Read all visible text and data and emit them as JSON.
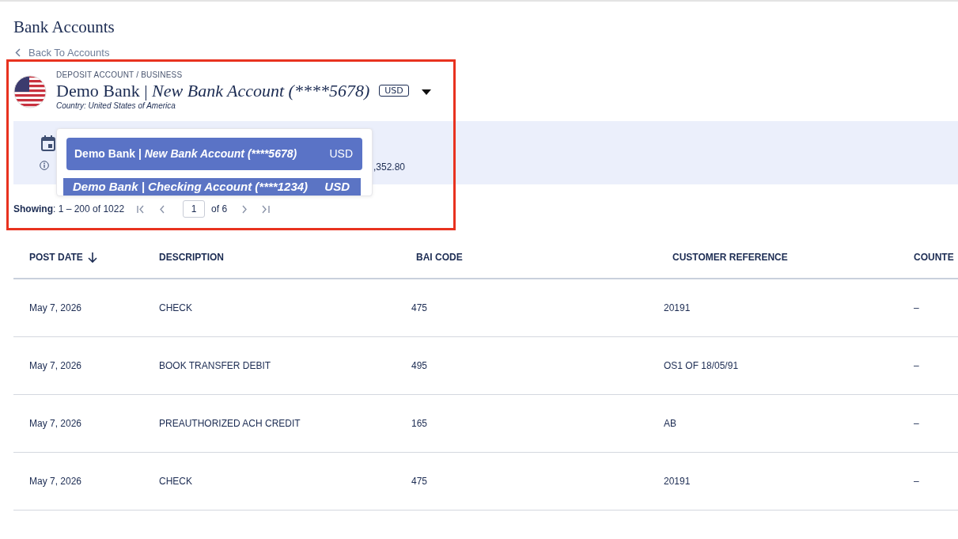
{
  "page_title": "Bank Accounts",
  "back_link": "Back To Accounts",
  "account": {
    "type_label": "DEPOSIT ACCOUNT / BUSINESS",
    "bank": "Demo Bank | ",
    "name": "New Bank Account (****5678)",
    "currency": "USD",
    "country": "Country: United States of America",
    "expanded": true
  },
  "dropdown": [
    {
      "bank": "Demo Bank | ",
      "name": "New Bank Account (****5678)",
      "currency": "USD",
      "selected": true
    },
    {
      "bank": "Demo Bank | ",
      "name": "Checking Account (****1234)",
      "currency": "USD",
      "selected": false
    }
  ],
  "info_panel": {
    "balance_fragment": ",352.80"
  },
  "pagination": {
    "label": "Showing",
    "range": ": 1 – 200 of 1022",
    "page": "1",
    "of_pages": "of 6"
  },
  "table": {
    "columns": [
      {
        "label": "POST DATE",
        "sorted": true
      },
      {
        "label": "DESCRIPTION",
        "sorted": false
      },
      {
        "label": "BAI CODE",
        "sorted": false
      },
      {
        "label": "CUSTOMER REFERENCE",
        "sorted": false
      },
      {
        "label": "COUNTE"
      }
    ],
    "rows": [
      [
        "May 7, 2026",
        "CHECK",
        "475",
        "20191",
        "–"
      ],
      [
        "May 7, 2026",
        "BOOK TRANSFER DEBIT",
        "495",
        "OS1 OF 18/05/91",
        "–"
      ],
      [
        "May 7, 2026",
        "PREAUTHORIZED ACH CREDIT",
        "165",
        "AB",
        "–"
      ],
      [
        "May 7, 2026",
        "CHECK",
        "475",
        "20191",
        "–"
      ]
    ]
  }
}
